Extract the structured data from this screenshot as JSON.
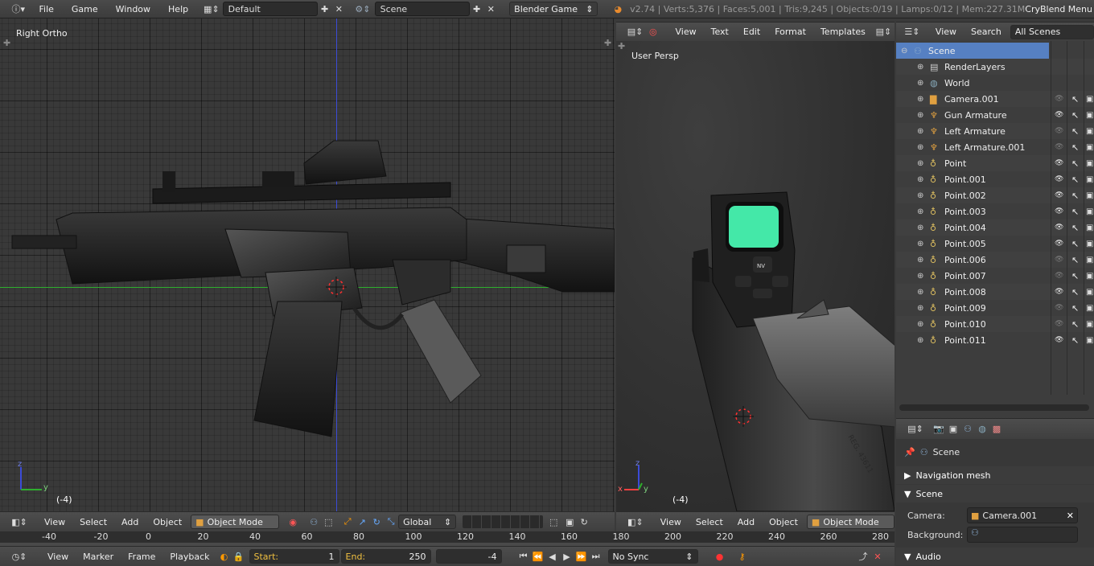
{
  "topbar": {
    "menus": [
      "File",
      "Game",
      "Window",
      "Help"
    ],
    "layout": "Default",
    "scene": "Scene",
    "engine": "Blender Game",
    "stats": "v2.74 | Verts:5,376 | Faces:5,001 | Tris:9,245 | Objects:0/19 | Lamps:0/12 | Mem:227.31M",
    "addon_menu": "CryBlend Menu"
  },
  "left_view": {
    "label": "Right Ortho",
    "frame": "(-4)"
  },
  "right_view": {
    "label": "User Persp",
    "frame": "(-4)"
  },
  "text_editor_header": {
    "menus": [
      "View",
      "Text",
      "Edit",
      "Format",
      "Templates"
    ]
  },
  "outliner": {
    "menus": [
      "View",
      "Search"
    ],
    "filter": "All Scenes",
    "rows": [
      {
        "name": "Scene",
        "depth": 0,
        "icon": "scene-icon",
        "vis": "none",
        "selected": true
      },
      {
        "name": "RenderLayers",
        "depth": 1,
        "icon": "render-layers-icon",
        "vis": "none"
      },
      {
        "name": "World",
        "depth": 1,
        "icon": "world-icon",
        "vis": "none"
      },
      {
        "name": "Camera.001",
        "depth": 1,
        "icon": "camera-icon",
        "vis": "dim"
      },
      {
        "name": "Gun Armature",
        "depth": 1,
        "icon": "armature-icon",
        "vis": "on"
      },
      {
        "name": "Left Armature",
        "depth": 1,
        "icon": "armature-icon",
        "vis": "dim"
      },
      {
        "name": "Left Armature.001",
        "depth": 1,
        "icon": "armature-icon",
        "vis": "dim"
      },
      {
        "name": "Point",
        "depth": 1,
        "icon": "lamp-icon",
        "vis": "on"
      },
      {
        "name": "Point.001",
        "depth": 1,
        "icon": "lamp-icon",
        "vis": "on"
      },
      {
        "name": "Point.002",
        "depth": 1,
        "icon": "lamp-icon",
        "vis": "on"
      },
      {
        "name": "Point.003",
        "depth": 1,
        "icon": "lamp-icon",
        "vis": "on"
      },
      {
        "name": "Point.004",
        "depth": 1,
        "icon": "lamp-icon",
        "vis": "on"
      },
      {
        "name": "Point.005",
        "depth": 1,
        "icon": "lamp-icon",
        "vis": "on"
      },
      {
        "name": "Point.006",
        "depth": 1,
        "icon": "lamp-icon",
        "vis": "dim"
      },
      {
        "name": "Point.007",
        "depth": 1,
        "icon": "lamp-icon",
        "vis": "dim"
      },
      {
        "name": "Point.008",
        "depth": 1,
        "icon": "lamp-icon",
        "vis": "on"
      },
      {
        "name": "Point.009",
        "depth": 1,
        "icon": "lamp-icon",
        "vis": "dim"
      },
      {
        "name": "Point.010",
        "depth": 1,
        "icon": "lamp-icon",
        "vis": "dim"
      },
      {
        "name": "Point.011",
        "depth": 1,
        "icon": "lamp-icon",
        "vis": "on"
      }
    ]
  },
  "properties": {
    "context": "Scene",
    "panels": [
      {
        "name": "Navigation mesh",
        "open": false
      },
      {
        "name": "Scene",
        "open": true
      },
      {
        "name": "Audio",
        "open": true
      }
    ],
    "camera_label": "Camera:",
    "camera_value": "Camera.001",
    "background_label": "Background:"
  },
  "view3d_header": {
    "menus": [
      "View",
      "Select",
      "Add",
      "Object"
    ],
    "mode": "Object Mode",
    "orientation": "Global"
  },
  "timeline": {
    "ticks": [
      "-40",
      "-20",
      "0",
      "20",
      "40",
      "60",
      "80",
      "100",
      "120",
      "140",
      "160",
      "180",
      "200",
      "220",
      "240",
      "260",
      "280"
    ],
    "menus": [
      "View",
      "Marker",
      "Frame",
      "Playback"
    ],
    "start_label": "Start:",
    "start": "1",
    "end_label": "End:",
    "end": "250",
    "current": "-4",
    "sync": "No Sync"
  },
  "colors": {
    "accent": "#5680c2",
    "green_screen": "#44e8a8",
    "x_axis": "#ff4040",
    "y_axis": "#2eae2e",
    "z_axis": "#3b4bd8"
  }
}
